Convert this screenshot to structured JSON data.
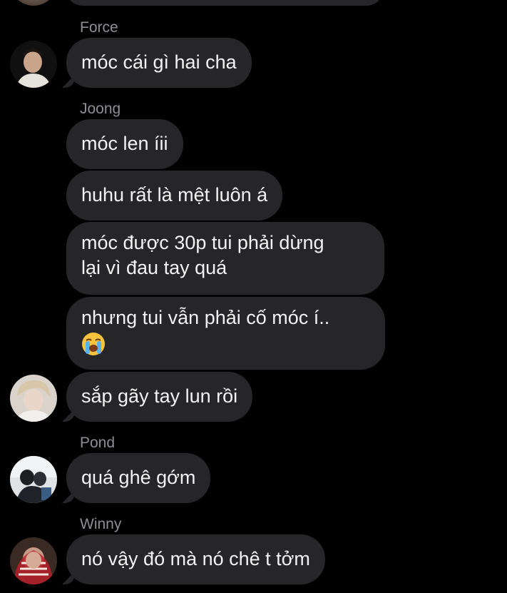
{
  "messages": {
    "m0_sender": "Force",
    "m0_text": "móc cái gì hai cha",
    "m1_sender": "Joong",
    "m1_text": "móc len íii",
    "m2_text": "huhu rất là mệt luôn á",
    "m3_line1": "móc được 30p tui phải dừng",
    "m3_line2": "lại vì đau tay quá",
    "m4_text": "nhưng tui vẫn phải cố móc í..",
    "m4_emoji": "loudly-crying-face-emoji",
    "m5_text": "sắp gãy tay lun rồi",
    "m6_sender": "Pond",
    "m6_text": "quá ghê gớm",
    "m7_sender": "Winny",
    "m7_text": "nó vậy đó mà nó chê t tởm"
  },
  "colors": {
    "background": "#000000",
    "bubble": "#262628",
    "text": "#f2f2f2",
    "sender": "#8e8e93"
  }
}
